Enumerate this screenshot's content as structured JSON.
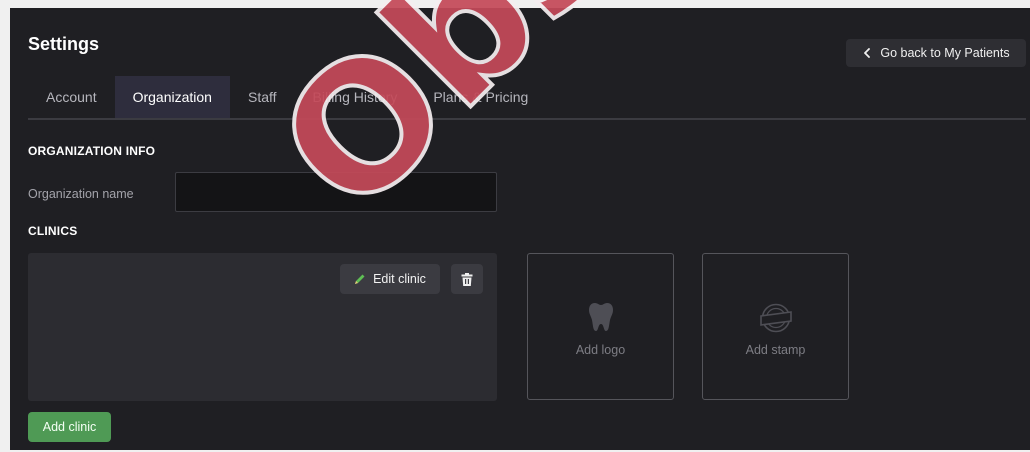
{
  "header": {
    "title": "Settings",
    "back_button": "Go back to My Patients"
  },
  "tabs": [
    {
      "label": "Account",
      "active": false
    },
    {
      "label": "Organization",
      "active": true
    },
    {
      "label": "Staff",
      "active": false
    },
    {
      "label": "Billing History",
      "active": false
    },
    {
      "label": "Plans & Pricing",
      "active": false
    }
  ],
  "organization_info": {
    "heading": "ORGANIZATION INFO",
    "name_label": "Organization name",
    "name_value": ""
  },
  "clinics": {
    "heading": "CLINICS",
    "edit_label": "Edit clinic",
    "add_logo_label": "Add logo",
    "add_stamp_label": "Add stamp",
    "add_clinic_label": "Add clinic"
  },
  "watermark": {
    "text": "Obso"
  },
  "colors": {
    "background": "#1f1f23",
    "active_tab": "#2e2d3d",
    "primary_button": "#4f9a55",
    "watermark": "#c44a59"
  },
  "icons": {
    "back": "chevron-left-icon",
    "edit": "pencil-icon",
    "delete": "trash-icon",
    "logo": "tooth-icon",
    "stamp": "stamp-icon"
  }
}
